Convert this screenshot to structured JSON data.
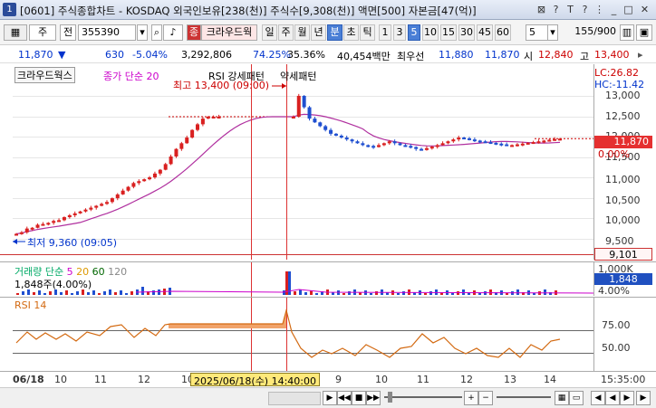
{
  "window": {
    "title": "[0601] 주식종합차트 - KOSDAQ 외국인보유[238(천)] 주식수[9,308(천)] 액면[500] 자본금[47(억)]",
    "icon": "1"
  },
  "toolbar": {
    "market": "주",
    "prev": "전",
    "code": "355390",
    "stock_name": "크라우드웍",
    "stock_tag": "종",
    "periods": [
      "일",
      "주",
      "월",
      "년",
      "분",
      "초",
      "틱"
    ],
    "selected_period": "분",
    "intervals": [
      "1",
      "3",
      "5",
      "10",
      "15",
      "30",
      "45",
      "60"
    ],
    "selected_interval": "5",
    "interval_value": "5",
    "count": "155",
    "total": "/900"
  },
  "info": {
    "price": "11,870",
    "change": "630",
    "change_pct": "-5.04%",
    "volume": "3,292,806",
    "rate1": "74.25%",
    "rate2": "35.36%",
    "amount": "40,454백만",
    "prio_label": "최우선",
    "prio1": "11,880",
    "prio2": "11,870",
    "open_label": "시",
    "open": "12,840",
    "high_label": "고",
    "high": "13,400",
    "colors": {
      "down": "#0033cc",
      "up": "#cc0000"
    }
  },
  "price_panel": {
    "name": "크라우드웍스",
    "ma_label": "종가 단순 20",
    "rsi_label": "RSI 강세패턴",
    "weak_label": "약세패턴",
    "max_label": "최고 13,400 (09:00)",
    "min_label": "최저 9,360 (09:05)",
    "lc": "LC:26.82",
    "hc": "HC:-11.42",
    "axis": [
      "13,000",
      "12,500",
      "12,000",
      "11,500",
      "11,000",
      "10,500",
      "10,000",
      "9,500"
    ],
    "current_price": "11,870",
    "current_pct": "0.00%",
    "cursor_value": "9,101"
  },
  "volume_panel": {
    "title": "거래량",
    "ma": "단순",
    "ma_periods": [
      "5",
      "20",
      "60",
      "120"
    ],
    "current": "1,848주(4.00%)",
    "axis_top": "1,000K",
    "axis_current": "1,848",
    "axis_pct": "4.00%"
  },
  "rsi_panel": {
    "title": "RSI 14",
    "axis": [
      "75.00",
      "50.00"
    ]
  },
  "dates": {
    "labels": [
      "06/18",
      "10",
      "11",
      "12",
      "10",
      "11",
      "12",
      "13",
      "14",
      "15",
      "9",
      "10",
      "11",
      "12",
      "13",
      "14",
      "15"
    ],
    "cursor": "2025/06/18(수) 14:40:00",
    "time": "15:35:00"
  },
  "chart_data": {
    "type": "candlestick",
    "series": [
      {
        "values": [
          9360,
          9400,
          9500,
          9520,
          9600,
          9620,
          9650,
          9700,
          9720,
          9800,
          9850,
          9900,
          9950,
          10000,
          10050,
          10100,
          10150,
          10200,
          10300,
          10400,
          10500,
          10600,
          10700,
          10750,
          10800,
          10850,
          10950,
          11050,
          11200,
          11400,
          11600,
          11750,
          11900,
          12100,
          12250,
          12400,
          12450,
          12450,
          12450,
          12450,
          12450,
          12450,
          12450,
          12450,
          12450,
          12450,
          12450,
          12450,
          12450,
          12450,
          12450,
          12450,
          12450,
          13000,
          12700,
          12400,
          12300,
          12200,
          12100,
          12000,
          11950,
          11900,
          11850,
          11800,
          11750,
          11700,
          11680,
          11650,
          11700,
          11750,
          11800,
          11750,
          11700,
          11680,
          11650,
          11600,
          11580,
          11620,
          11660,
          11700,
          11750,
          11800,
          11850,
          11900,
          11880,
          11850,
          11820,
          11800,
          11780,
          11760,
          11740,
          11720,
          11700,
          11700,
          11720,
          11740,
          11760,
          11780,
          11800,
          11820,
          11840,
          11860,
          11870
        ]
      }
    ],
    "ylim": [
      9300,
      13500
    ]
  }
}
